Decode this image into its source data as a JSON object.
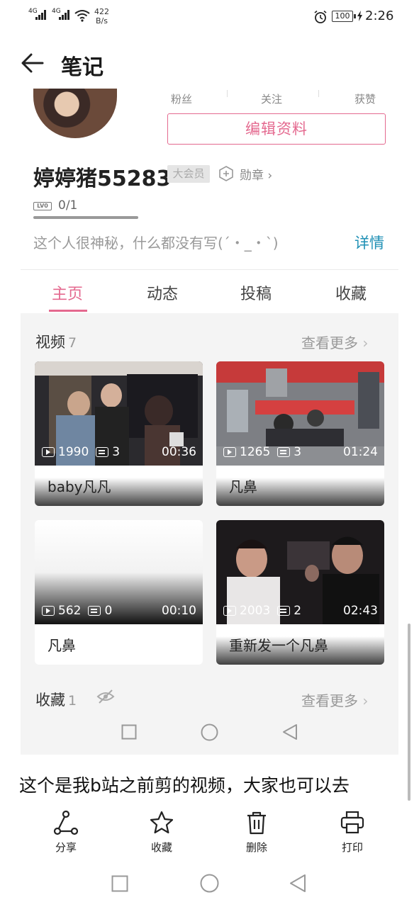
{
  "status_bar": {
    "sig1": "4G",
    "sig2": "4G",
    "speed_value": "422",
    "speed_unit": "B/s",
    "battery": "100",
    "time": "2:26"
  },
  "header": {
    "title": "笔记"
  },
  "profile": {
    "stats": [
      "粉丝",
      "关注",
      "获赞"
    ],
    "edit_button": "编辑资料",
    "username": "婷婷猪55283",
    "vip_badge": "大会员",
    "medal": "勋章",
    "level_icon": "LV0",
    "level_progress": "0/1",
    "bio": "这个人很神秘，什么都没有写(´・_・`)",
    "detail": "详情"
  },
  "tabs": [
    {
      "label": "主页",
      "active": true
    },
    {
      "label": "动态",
      "active": false
    },
    {
      "label": "投稿",
      "active": false
    },
    {
      "label": "收藏",
      "active": false
    }
  ],
  "videos_section": {
    "title": "视频",
    "count": "7",
    "more": "查看更多"
  },
  "videos": [
    {
      "plays": "1990",
      "danmaku": "3",
      "duration": "00:36",
      "title": "baby凡凡"
    },
    {
      "plays": "1265",
      "danmaku": "3",
      "duration": "01:24",
      "title": "凡鼻"
    },
    {
      "plays": "562",
      "danmaku": "0",
      "duration": "00:10",
      "title": "凡鼻"
    },
    {
      "plays": "2003",
      "danmaku": "2",
      "duration": "02:43",
      "title": "重新发一个凡鼻"
    }
  ],
  "favorites_section": {
    "title": "收藏",
    "count": "1",
    "more": "查看更多"
  },
  "note": {
    "body": "这个是我b站之前剪的视频，大家也可以去"
  },
  "toolbar": {
    "share": "分享",
    "favorite": "收藏",
    "delete": "删除",
    "print": "打印"
  },
  "colors": {
    "accent": "#e4698f",
    "link": "#1f90b5"
  }
}
